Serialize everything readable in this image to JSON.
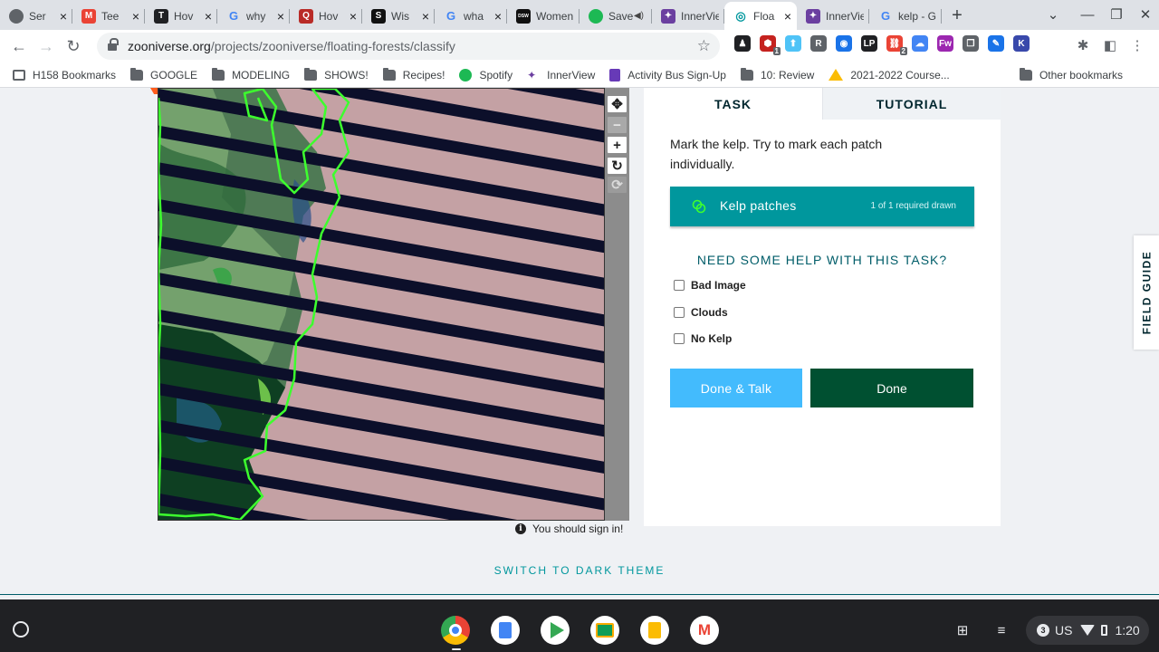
{
  "browser": {
    "tabs": [
      {
        "label": "Ser",
        "icon": "globe-icon",
        "color": "#5f6368",
        "glyph": ""
      },
      {
        "label": "Tee",
        "icon": "gmail-icon",
        "color": "#ea4335",
        "glyph": "M"
      },
      {
        "label": "Hov",
        "icon": "tool-icon",
        "color": "#202124",
        "glyph": "T"
      },
      {
        "label": "why",
        "icon": "google-icon",
        "color": "#4285f4",
        "glyph": "G"
      },
      {
        "label": "Hov",
        "icon": "quora-icon",
        "color": "#b92b27",
        "glyph": "Q"
      },
      {
        "label": "Wis",
        "icon": "s-icon",
        "color": "#111111",
        "glyph": "S"
      },
      {
        "label": "wha",
        "icon": "google-icon",
        "color": "#4285f4",
        "glyph": "G"
      },
      {
        "label": "Women",
        "icon": "dsw-icon",
        "color": "#111111",
        "glyph": "DSW"
      },
      {
        "label": "Save",
        "icon": "spotify-icon",
        "color": "#1db954",
        "glyph": ""
      },
      {
        "label": "InnerVie",
        "icon": "innerview-icon",
        "color": "#6b3fa0",
        "glyph": "✦"
      },
      {
        "label": "Floa",
        "icon": "zooniverse-icon",
        "color": "#00979d",
        "glyph": "◎"
      },
      {
        "label": "InnerVie",
        "icon": "innerview-icon",
        "color": "#6b3fa0",
        "glyph": "✦"
      },
      {
        "label": "kelp - G",
        "icon": "google-icon",
        "color": "#4285f4",
        "glyph": "G"
      }
    ],
    "active_tab": 10,
    "url_host": "zooniverse.org",
    "url_path": "/projects/zooniverse/floating-forests/classify",
    "bookmarks": [
      {
        "label": "H158 Bookmarks",
        "icon": "bookmark-folder-icon"
      },
      {
        "label": "GOOGLE",
        "icon": "folder-icon"
      },
      {
        "label": "MODELING",
        "icon": "folder-icon"
      },
      {
        "label": "SHOWS!",
        "icon": "folder-icon"
      },
      {
        "label": "Recipes!",
        "icon": "folder-icon"
      },
      {
        "label": "Spotify",
        "icon": "spotify-icon"
      },
      {
        "label": "InnerView",
        "icon": "innerview-icon"
      },
      {
        "label": "Activity Bus Sign-Up",
        "icon": "forms-icon"
      },
      {
        "label": "10: Review",
        "icon": "folder-icon"
      },
      {
        "label": "2021-2022 Course...",
        "icon": "drive-icon"
      }
    ],
    "bookmarks_more": "»",
    "other_bookmarks": "Other bookmarks",
    "extensions": [
      {
        "glyph": "♟",
        "color": "#202124",
        "badge": ""
      },
      {
        "glyph": "⬢",
        "color": "#c5221f",
        "badge": "1"
      },
      {
        "glyph": "⬆",
        "color": "#4fc3f7",
        "badge": ""
      },
      {
        "glyph": "R",
        "color": "#5f6368",
        "badge": ""
      },
      {
        "glyph": "◉",
        "color": "#1a73e8",
        "badge": ""
      },
      {
        "glyph": "LP",
        "color": "#202124",
        "badge": ""
      },
      {
        "glyph": "⛓",
        "color": "#ea4335",
        "badge": "2"
      },
      {
        "glyph": "☁",
        "color": "#4285f4",
        "badge": ""
      },
      {
        "glyph": "Fw",
        "color": "#9c27b0",
        "badge": ""
      },
      {
        "glyph": "❐",
        "color": "#5f6368",
        "badge": ""
      },
      {
        "glyph": "✎",
        "color": "#1a73e8",
        "badge": ""
      },
      {
        "glyph": "K",
        "color": "#3949ab",
        "badge": ""
      }
    ]
  },
  "classifier": {
    "tabs": {
      "task": "TASK",
      "tutorial": "TUTORIAL"
    },
    "instruction": "Mark the kelp. Try to mark each patch individually.",
    "tool": {
      "label": "Kelp patches",
      "count": "1 of 1 required drawn",
      "color": "#00979d"
    },
    "help_heading": "NEED SOME HELP WITH THIS TASK?",
    "options": [
      {
        "label": "Bad Image",
        "checked": false
      },
      {
        "label": "Clouds",
        "checked": false
      },
      {
        "label": "No Kelp",
        "checked": false
      }
    ],
    "done_talk_label": "Done & Talk",
    "done_label": "Done",
    "signin_notice": "You should sign in!",
    "field_guide": "FIELD GUIDE",
    "dark_theme": "SWITCH TO DARK THEME",
    "zoom_controls": [
      "move-icon",
      "zoom-out-icon",
      "zoom-in-icon",
      "rotate-icon",
      "reset-icon"
    ]
  },
  "shelf": {
    "apps": [
      {
        "name": "chrome-icon",
        "color": "#ea4335"
      },
      {
        "name": "docs-icon",
        "color": "#4285f4"
      },
      {
        "name": "play-store-icon",
        "color": "#34a853"
      },
      {
        "name": "classroom-icon",
        "color": "#0f9d58"
      },
      {
        "name": "keep-icon",
        "color": "#fbbc04"
      },
      {
        "name": "gmail-icon",
        "color": "#ea4335"
      }
    ],
    "notification_count": "3",
    "locale": "US",
    "time": "1:20"
  }
}
